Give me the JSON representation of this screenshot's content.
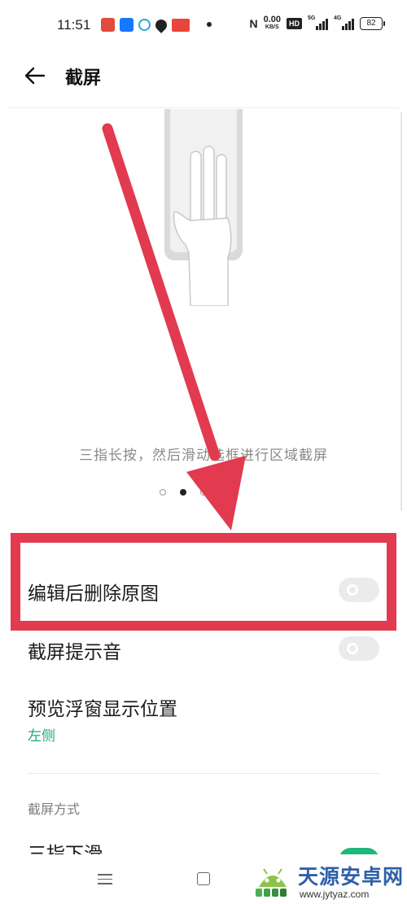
{
  "status_bar": {
    "time": "11:51",
    "nfc_label": "N",
    "net_speed_value": "0.00",
    "net_speed_unit": "KB/S",
    "hd_label": "HD",
    "signal1_tag": "5G",
    "signal2_tag": "4G",
    "battery": "82",
    "notification_icons": [
      "baidu-icon",
      "alipay-icon",
      "ring-app-icon",
      "map-pin-icon",
      "red-app-icon"
    ]
  },
  "header": {
    "back_icon": "arrow-left-icon",
    "title": "截屏"
  },
  "illustration": {
    "caption": "三指长按，然后滑动选框进行区域截屏",
    "page_count": 4,
    "active_page_index": 1
  },
  "settings": [
    {
      "label": "编辑后删除原图",
      "toggle_on": false
    },
    {
      "label": "截屏提示音",
      "toggle_on": false
    },
    {
      "label": "预览浮窗显示位置",
      "value": "左侧"
    }
  ],
  "section": {
    "title": "截屏方式",
    "rows": [
      {
        "label": "三指下滑",
        "toggle_on": true
      }
    ]
  },
  "nav_bar": {
    "icons": [
      "menu-icon",
      "home-icon"
    ]
  },
  "watermark": {
    "name": "天源安卓网",
    "url": "www.jytyaz.com"
  },
  "annotation_colors": {
    "highlight": "#e23a4f",
    "arrow": "#e23a4f",
    "accent_green": "#1fb77a"
  }
}
